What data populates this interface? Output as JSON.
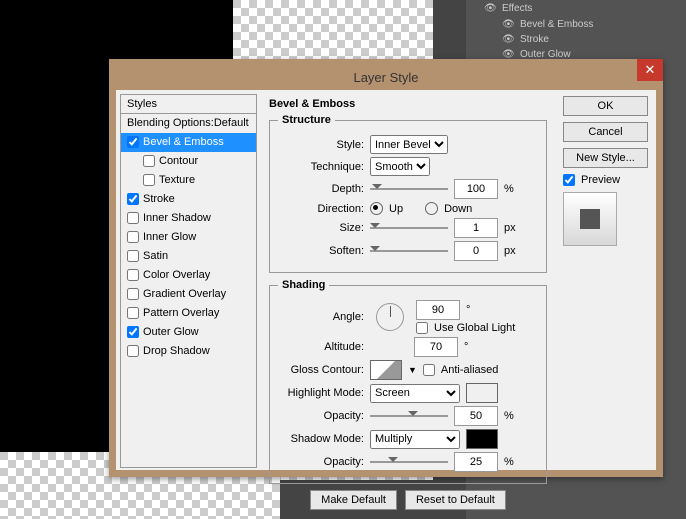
{
  "effects_panel": {
    "title": "Effects",
    "items": [
      "Bevel & Emboss",
      "Stroke",
      "Outer Glow"
    ]
  },
  "dialog": {
    "title": "Layer Style",
    "styles_header": "Styles",
    "blending": "Blending Options:Default",
    "list": [
      {
        "label": "Bevel & Emboss",
        "checked": true,
        "selected": true
      },
      {
        "label": "Contour",
        "checked": false,
        "sub": true
      },
      {
        "label": "Texture",
        "checked": false,
        "sub": true
      },
      {
        "label": "Stroke",
        "checked": true
      },
      {
        "label": "Inner Shadow",
        "checked": false
      },
      {
        "label": "Inner Glow",
        "checked": false
      },
      {
        "label": "Satin",
        "checked": false
      },
      {
        "label": "Color Overlay",
        "checked": false
      },
      {
        "label": "Gradient Overlay",
        "checked": false
      },
      {
        "label": "Pattern Overlay",
        "checked": false
      },
      {
        "label": "Outer Glow",
        "checked": true
      },
      {
        "label": "Drop Shadow",
        "checked": false
      }
    ],
    "section_title": "Bevel & Emboss",
    "structure": {
      "legend": "Structure",
      "style_label": "Style:",
      "style_value": "Inner Bevel",
      "technique_label": "Technique:",
      "technique_value": "Smooth",
      "depth_label": "Depth:",
      "depth_value": "100",
      "depth_unit": "%",
      "direction_label": "Direction:",
      "up": "Up",
      "down": "Down",
      "size_label": "Size:",
      "size_value": "1",
      "size_unit": "px",
      "soften_label": "Soften:",
      "soften_value": "0",
      "soften_unit": "px"
    },
    "shading": {
      "legend": "Shading",
      "angle_label": "Angle:",
      "angle_value": "90",
      "degree": "°",
      "global": "Use Global Light",
      "altitude_label": "Altitude:",
      "altitude_value": "70",
      "gloss_label": "Gloss Contour:",
      "anti": "Anti-aliased",
      "highlight_label": "Highlight Mode:",
      "highlight_value": "Screen",
      "highlight_color": "#ffffff",
      "opacity_label": "Opacity:",
      "highlight_opacity": "50",
      "shadow_label": "Shadow Mode:",
      "shadow_value": "Multiply",
      "shadow_color": "#000000",
      "shadow_opacity": "25",
      "pct": "%"
    },
    "make_default": "Make Default",
    "reset_default": "Reset to Default",
    "ok": "OK",
    "cancel": "Cancel",
    "new_style": "New Style...",
    "preview": "Preview"
  }
}
